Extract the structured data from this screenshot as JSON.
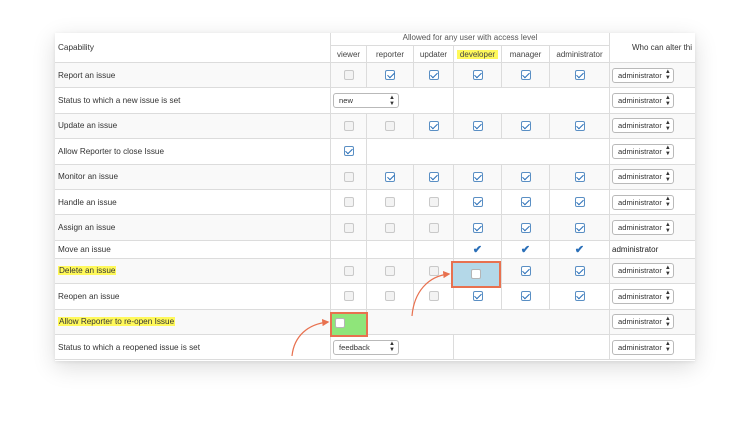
{
  "header": {
    "capability": "Capability",
    "group_label": "Allowed for any user with access level",
    "who_label": "Who can alter thi",
    "levels": [
      "viewer",
      "reporter",
      "updater",
      "developer",
      "manager",
      "administrator"
    ]
  },
  "rows": [
    {
      "label": "Report an issue"
    },
    {
      "label": "Status to which a new issue is set",
      "status_value": "new"
    },
    {
      "label": "Update an issue"
    },
    {
      "label": "Allow Reporter to close Issue"
    },
    {
      "label": "Monitor an issue"
    },
    {
      "label": "Handle an issue"
    },
    {
      "label": "Assign an issue"
    },
    {
      "label": "Move an issue",
      "who_text": "administrator"
    },
    {
      "label": "Delete an issue"
    },
    {
      "label": "Reopen an issue"
    },
    {
      "label": "Allow Reporter to re-open Issue"
    },
    {
      "label": "Status to which a reopened issue is set",
      "status_value": "feedback"
    }
  ],
  "who_select_value": "administrator",
  "colors": {
    "highlight_yellow": "#fff95a",
    "highlight_blue": "#b4d8e8",
    "highlight_green": "#8fe57a",
    "callout_border": "#e8714f",
    "check_blue": "#2a6fb8"
  }
}
